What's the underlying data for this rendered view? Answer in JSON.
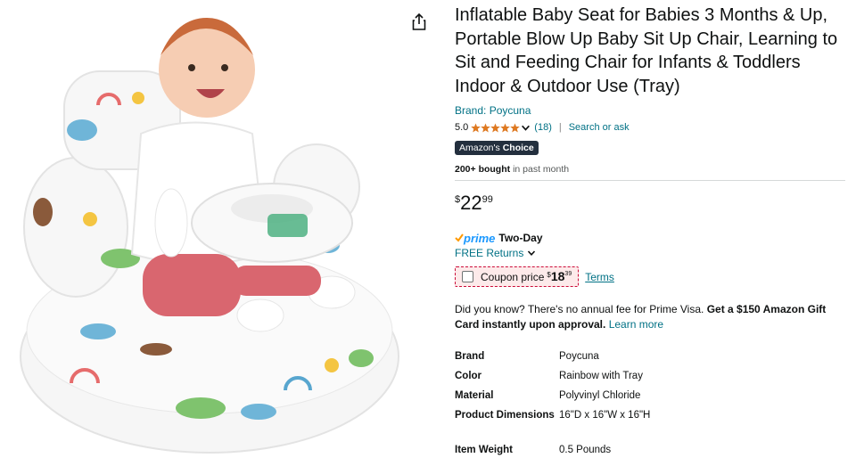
{
  "product": {
    "title": "Inflatable Baby Seat for Babies 3 Months & Up, Portable Blow Up Baby Sit Up Chair, Learning to Sit and Feeding Chair for Infants & Toddlers Indoor & Outdoor Use (Tray)",
    "brand_link": "Brand: Poycuna",
    "rating_value": "5.0",
    "rating_stars": 5,
    "rating_count": "(18)",
    "search_or_ask": "Search or ask",
    "badge_prefix": "Amazon's",
    "badge_suffix": "Choice",
    "bought_bold": "200+ bought",
    "bought_rest": "in past month"
  },
  "price": {
    "symbol": "$",
    "whole": "22",
    "fraction": "99"
  },
  "delivery": {
    "prime_label": "prime",
    "prime_speed": "Two-Day",
    "free_returns": "FREE Returns"
  },
  "coupon": {
    "label": "Coupon price",
    "symbol": "$",
    "whole": "18",
    "fraction": "39",
    "terms": "Terms"
  },
  "promo": {
    "text": "Did you know? There's no annual fee for Prime Visa.",
    "bold": "Get a $150 Amazon Gift Card instantly upon approval.",
    "link": "Learn more"
  },
  "specs": [
    {
      "key": "Brand",
      "value": "Poycuna"
    },
    {
      "key": "Color",
      "value": "Rainbow with Tray"
    },
    {
      "key": "Material",
      "value": "Polyvinyl Chloride"
    },
    {
      "key": "Product Dimensions",
      "value": "16\"D x 16\"W x 16\"H"
    },
    {
      "key": "Item Weight",
      "value": "0.5 Pounds"
    }
  ],
  "colors": {
    "link": "#007185",
    "star": "#de7921",
    "prime": "#1a98ff",
    "badge_bg": "#232f3e",
    "coupon_border": "#cc0c39",
    "coupon_bg": "#fdeaea"
  }
}
